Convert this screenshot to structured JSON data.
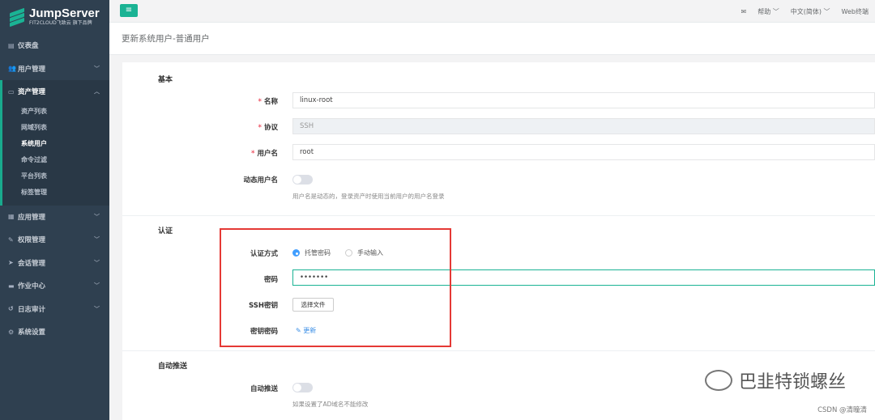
{
  "app": {
    "logo_title": "JumpServer",
    "logo_subtitle": "FIT2CLOUD飞致云 旗下品牌"
  },
  "topbar": {
    "mail_icon": "mail-icon",
    "help": "帮助",
    "language": "中文(简体)",
    "web_terminal": "Web终端"
  },
  "sidebar": {
    "items": [
      {
        "label": "仪表盘",
        "icon": "dashboard-icon"
      },
      {
        "label": "用户管理",
        "icon": "users-icon"
      },
      {
        "label": "资产管理",
        "icon": "assets-icon"
      },
      {
        "label": "应用管理",
        "icon": "apps-icon"
      },
      {
        "label": "权限管理",
        "icon": "perm-icon"
      },
      {
        "label": "会话管理",
        "icon": "session-icon"
      },
      {
        "label": "作业中心",
        "icon": "jobs-icon"
      },
      {
        "label": "日志审计",
        "icon": "audit-icon"
      },
      {
        "label": "系统设置",
        "icon": "gear-icon"
      }
    ],
    "subitems": [
      "资产列表",
      "网域列表",
      "系统用户",
      "命令过滤",
      "平台列表",
      "标签管理"
    ]
  },
  "page": {
    "title": "更新系统用户-普通用户"
  },
  "form": {
    "basic_section": "基本",
    "name_label": "名称",
    "name_value": "linux-root",
    "protocol_label": "协议",
    "protocol_value": "SSH",
    "username_label": "用户名",
    "username_value": "root",
    "dynamic_label": "动态用户名",
    "dynamic_hint": "用户名是动态的，登录资产时使用当前用户的用户名登录",
    "auth_section": "认证",
    "auth_method_label": "认证方式",
    "auth_option_managed": "托管密码",
    "auth_option_manual": "手动输入",
    "password_label": "密码",
    "password_value": "•••••••",
    "ssh_key_label": "SSH密钥",
    "choose_file": "选择文件",
    "key_pass_label": "密钥密码",
    "update_link": "更新",
    "autopush_section": "自动推送",
    "autopush_label": "自动推送",
    "autopush_hint": "如果设置了AD域名不能修改"
  },
  "watermark": {
    "text": "巴韭特锁螺丝",
    "csdn": "CSDN @清瞳清"
  }
}
